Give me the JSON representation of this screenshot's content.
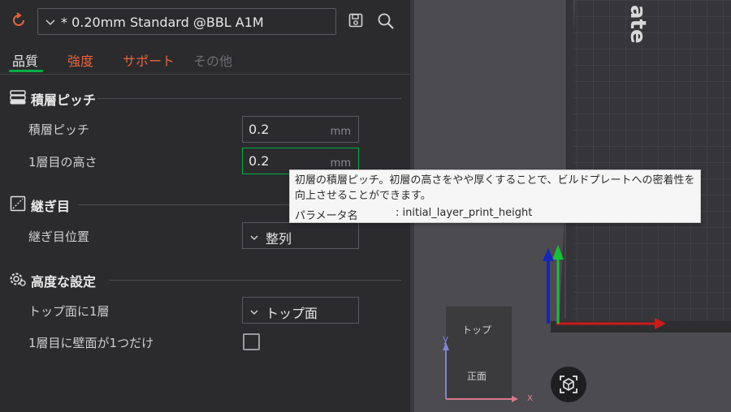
{
  "preset": {
    "name": "* 0.20mm Standard @BBL A1M"
  },
  "tabs": [
    {
      "label": "品質"
    },
    {
      "label": "強度"
    },
    {
      "label": "サポート"
    },
    {
      "label": "その他"
    }
  ],
  "sections": {
    "layer_height": {
      "title": "積層ピッチ",
      "rows": [
        {
          "label": "積層ピッチ",
          "value": "0.2",
          "unit": "mm"
        },
        {
          "label": "1層目の高さ",
          "value": "0.2",
          "unit": "mm"
        }
      ]
    },
    "seam": {
      "title": "継ぎ目",
      "rows": [
        {
          "label": "継ぎ目位置",
          "value": "整列"
        }
      ]
    },
    "advanced": {
      "title": "高度な設定",
      "rows": [
        {
          "label": "トップ面に1層",
          "value": "トップ面"
        },
        {
          "label": "1層目に壁面が1つだけ",
          "checked": false
        }
      ]
    }
  },
  "tooltip": {
    "description": "初層の積層ピッチ。初層の高さをやや厚くすることで、ビルドプレートへの密着性を向上させることができます。",
    "param_label": "パラメータ名",
    "param_value": ": initial_layer_print_height"
  },
  "viewport": {
    "plate_text": "ate",
    "viewcube_top": "トップ",
    "viewcube_front": "正面",
    "axis_x_label": "x",
    "axis_y_label": "y"
  },
  "colors": {
    "accent_green": "#00ae42",
    "accent_orange": "#e9623b",
    "disabled_tab": "#6d6d70",
    "panel_bg": "#2b2b2e",
    "viewport_bg": "#4b4b50"
  },
  "icons": [
    "reset-icon",
    "chevron-down-icon",
    "save-icon",
    "search-icon",
    "layers-icon",
    "seam-icon",
    "gear-icon",
    "camera-view-icon"
  ]
}
